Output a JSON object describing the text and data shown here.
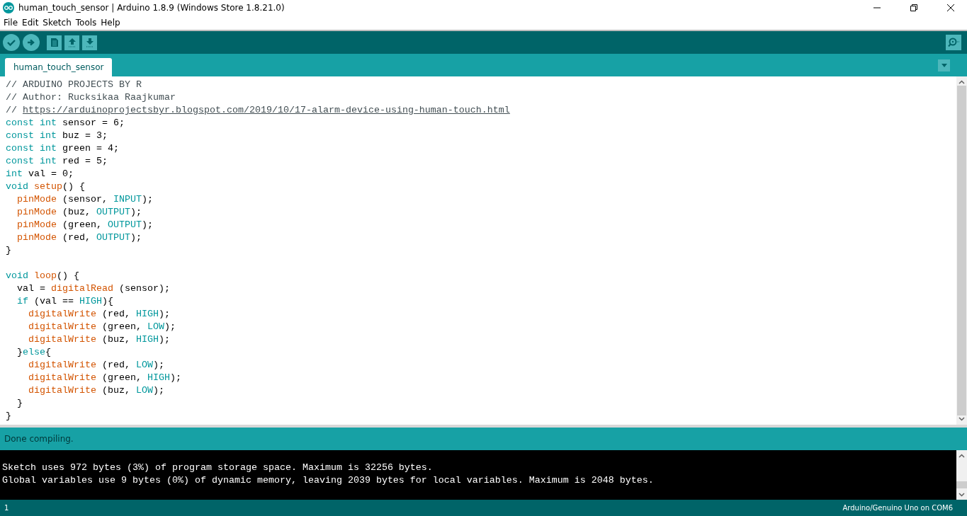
{
  "window": {
    "title": "human_touch_sensor | Arduino 1.8.9 (Windows Store 1.8.21.0)"
  },
  "menu": [
    "File",
    "Edit",
    "Sketch",
    "Tools",
    "Help"
  ],
  "toolbar": [
    {
      "kind": "verify"
    },
    {
      "kind": "upload"
    },
    {
      "kind": "new"
    },
    {
      "kind": "open"
    },
    {
      "kind": "save"
    }
  ],
  "tabs": [
    {
      "label": "human_touch_sensor",
      "selected": true
    }
  ],
  "code": [
    {
      "lines": [
        {
          "tokens": [
            {
              "kind": "comment",
              "text": "// ARDUINO PROJECTS BY R"
            }
          ]
        },
        {
          "tokens": [
            {
              "kind": "comment",
              "text": "// Author: Rucksikaa Raajkumar"
            }
          ]
        },
        {
          "tokens": [
            {
              "kind": "comment",
              "text": "// "
            },
            {
              "kind": "link",
              "text": "https://arduinoprojectsbyr.blogspot.com/2019/10/17-alarm-device-using-human-touch.html"
            }
          ]
        },
        {
          "tokens": [
            {
              "kind": "keyword",
              "text": "const int"
            },
            {
              "kind": "plain",
              "text": " sensor = 6;"
            }
          ]
        },
        {
          "tokens": [
            {
              "kind": "keyword",
              "text": "const int"
            },
            {
              "kind": "plain",
              "text": " buz = 3;"
            }
          ]
        },
        {
          "tokens": [
            {
              "kind": "keyword",
              "text": "const int"
            },
            {
              "kind": "plain",
              "text": " green = 4;"
            }
          ]
        },
        {
          "tokens": [
            {
              "kind": "keyword",
              "text": "const int"
            },
            {
              "kind": "plain",
              "text": " red = 5;"
            }
          ]
        },
        {
          "tokens": [
            {
              "kind": "keyword",
              "text": "int"
            },
            {
              "kind": "plain",
              "text": " val = 0;"
            }
          ]
        },
        {
          "tokens": [
            {
              "kind": "keyword",
              "text": "void "
            },
            {
              "kind": "function",
              "text": "setup"
            },
            {
              "kind": "plain",
              "text": "() {"
            }
          ]
        },
        {
          "tokens": [
            {
              "kind": "function",
              "text": "  pinMode"
            },
            {
              "kind": "plain",
              "text": " (sensor, "
            },
            {
              "kind": "constant",
              "text": "INPUT"
            },
            {
              "kind": "plain",
              "text": ");"
            }
          ]
        },
        {
          "tokens": [
            {
              "kind": "function",
              "text": "  pinMode"
            },
            {
              "kind": "plain",
              "text": " (buz, "
            },
            {
              "kind": "constant",
              "text": "OUTPUT"
            },
            {
              "kind": "plain",
              "text": ");"
            }
          ]
        },
        {
          "tokens": [
            {
              "kind": "function",
              "text": "  pinMode"
            },
            {
              "kind": "plain",
              "text": " (green, "
            },
            {
              "kind": "constant",
              "text": "OUTPUT"
            },
            {
              "kind": "plain",
              "text": ");"
            }
          ]
        },
        {
          "tokens": [
            {
              "kind": "function",
              "text": "  pinMode"
            },
            {
              "kind": "plain",
              "text": " (red, "
            },
            {
              "kind": "constant",
              "text": "OUTPUT"
            },
            {
              "kind": "plain",
              "text": ");"
            }
          ]
        },
        {
          "tokens": [
            {
              "kind": "plain",
              "text": "}"
            }
          ]
        }
      ]
    },
    {
      "lines": [
        {
          "tokens": [
            {
              "kind": "keyword",
              "text": "void "
            },
            {
              "kind": "function",
              "text": "loop"
            },
            {
              "kind": "plain",
              "text": "() {"
            }
          ]
        },
        {
          "tokens": [
            {
              "kind": "plain",
              "text": "  val = "
            },
            {
              "kind": "function",
              "text": "digitalRead"
            },
            {
              "kind": "plain",
              "text": " (sensor);"
            }
          ]
        },
        {
          "tokens": [
            {
              "kind": "keyword",
              "text": "  if"
            },
            {
              "kind": "plain",
              "text": " (val == "
            },
            {
              "kind": "constant",
              "text": "HIGH"
            },
            {
              "kind": "plain",
              "text": "){"
            }
          ]
        },
        {
          "tokens": [
            {
              "kind": "function",
              "text": "    digitalWrite"
            },
            {
              "kind": "plain",
              "text": " (red, "
            },
            {
              "kind": "constant",
              "text": "HIGH"
            },
            {
              "kind": "plain",
              "text": ");"
            }
          ]
        },
        {
          "tokens": [
            {
              "kind": "function",
              "text": "    digitalWrite"
            },
            {
              "kind": "plain",
              "text": " (green, "
            },
            {
              "kind": "constant",
              "text": "LOW"
            },
            {
              "kind": "plain",
              "text": ");"
            }
          ]
        },
        {
          "tokens": [
            {
              "kind": "function",
              "text": "    digitalWrite"
            },
            {
              "kind": "plain",
              "text": " (buz, "
            },
            {
              "kind": "constant",
              "text": "HIGH"
            },
            {
              "kind": "plain",
              "text": ");"
            }
          ]
        },
        {
          "tokens": [
            {
              "kind": "plain",
              "text": "  }"
            },
            {
              "kind": "keyword",
              "text": "else"
            },
            {
              "kind": "plain",
              "text": "{"
            }
          ]
        },
        {
          "tokens": [
            {
              "kind": "function",
              "text": "    digitalWrite"
            },
            {
              "kind": "plain",
              "text": " (red, "
            },
            {
              "kind": "constant",
              "text": "LOW"
            },
            {
              "kind": "plain",
              "text": ");"
            }
          ]
        },
        {
          "tokens": [
            {
              "kind": "function",
              "text": "    digitalWrite"
            },
            {
              "kind": "plain",
              "text": " (green, "
            },
            {
              "kind": "constant",
              "text": "HIGH"
            },
            {
              "kind": "plain",
              "text": ");"
            }
          ]
        },
        {
          "tokens": [
            {
              "kind": "function",
              "text": "    digitalWrite"
            },
            {
              "kind": "plain",
              "text": " (buz, "
            },
            {
              "kind": "constant",
              "text": "LOW"
            },
            {
              "kind": "plain",
              "text": ");"
            }
          ]
        },
        {
          "tokens": [
            {
              "kind": "plain",
              "text": "  }"
            }
          ]
        },
        {
          "tokens": [
            {
              "kind": "plain",
              "text": "}"
            }
          ]
        }
      ]
    }
  ],
  "status": "Done compiling.",
  "console": [
    "Sketch uses 972 bytes (3%) of program storage space. Maximum is 32256 bytes.",
    "Global variables use 9 bytes (0%) of dynamic memory, leaving 2039 bytes for local variables. Maximum is 2048 bytes."
  ],
  "footer": {
    "line": "1",
    "board": "Arduino/Genuino Uno on COM6"
  }
}
